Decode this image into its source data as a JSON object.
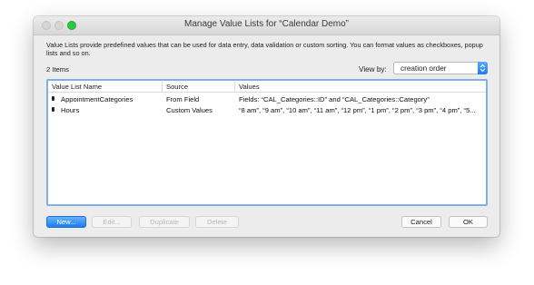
{
  "window": {
    "title": "Manage Value Lists for “Calendar Demo”"
  },
  "description": "Value Lists provide predefined values that can be used for data entry, data validation or custom sorting. You can format values as checkboxes, popup lists and so on.",
  "item_count": "2 Items",
  "view_by": {
    "label": "View by:",
    "selected": "creation order"
  },
  "table": {
    "columns": [
      "Value List Name",
      "Source",
      "Values"
    ],
    "rows": [
      {
        "name": "AppointmentCategories",
        "source": "From Field",
        "values": "Fields: “CAL_Categories::ID” and “CAL_Categories::Category”"
      },
      {
        "name": "Hours",
        "source": "Custom Values",
        "values": "“8 am”, “9 am”, “10 am”, “11 am”, “12 pm”, “1 pm”, “2 pm”, “3 pm”, “4 pm”, “5..."
      }
    ]
  },
  "buttons": {
    "new": "New...",
    "edit": "Edit...",
    "duplicate": "Duplicate",
    "delete": "Delete",
    "cancel": "Cancel",
    "ok": "OK"
  },
  "colors": {
    "accent": "#1f7cf2",
    "maximize": "#2ec840",
    "list_focus_ring": "#82aee9"
  },
  "icons": [
    "close-icon",
    "minimize-icon",
    "maximize-icon",
    "updown-chevron-icon",
    "drag-handle-icon"
  ]
}
